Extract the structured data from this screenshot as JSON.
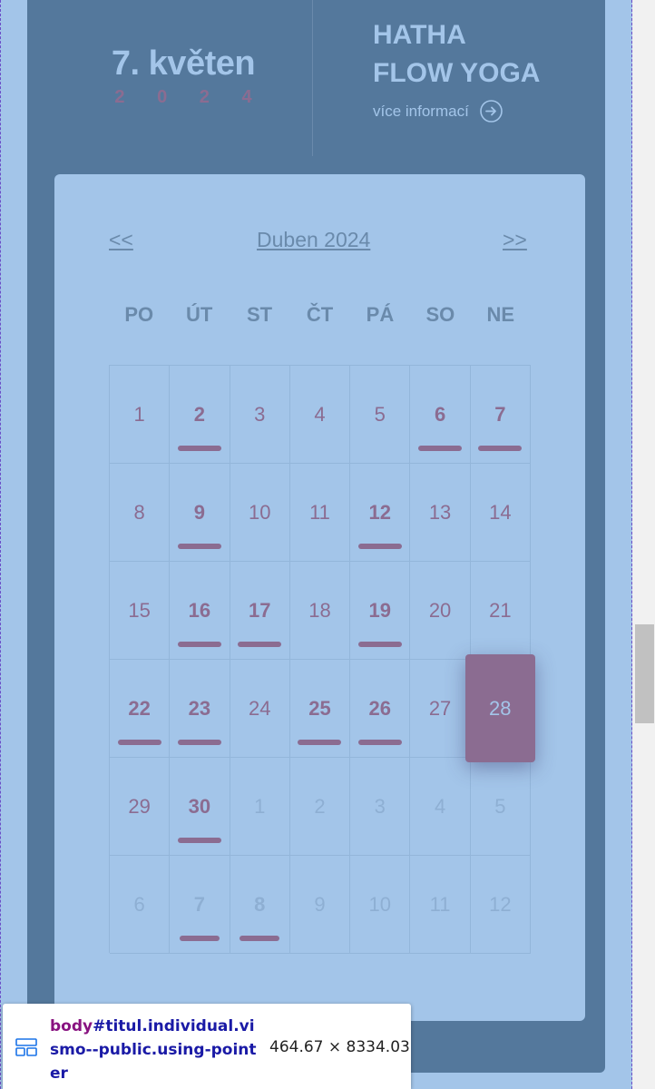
{
  "event": {
    "day_month": "7. květen",
    "year": "2 0 2 4",
    "title_line1": "HATHA",
    "title_line2": "FLOW YOGA",
    "more_label": "více informací"
  },
  "calendar": {
    "prev_label": "<<",
    "next_label": ">>",
    "month_label": "Duben 2024",
    "weekdays": [
      "PO",
      "ÚT",
      "ST",
      "ČT",
      "PÁ",
      "SO",
      "NE"
    ],
    "days": [
      {
        "label": "1",
        "event": false,
        "outside": false
      },
      {
        "label": "2",
        "event": true,
        "outside": false
      },
      {
        "label": "3",
        "event": false,
        "outside": false
      },
      {
        "label": "4",
        "event": false,
        "outside": false
      },
      {
        "label": "5",
        "event": false,
        "outside": false
      },
      {
        "label": "6",
        "event": true,
        "outside": false
      },
      {
        "label": "7",
        "event": true,
        "outside": false
      },
      {
        "label": "8",
        "event": false,
        "outside": false
      },
      {
        "label": "9",
        "event": true,
        "outside": false
      },
      {
        "label": "10",
        "event": false,
        "outside": false
      },
      {
        "label": "11",
        "event": false,
        "outside": false
      },
      {
        "label": "12",
        "event": true,
        "outside": false
      },
      {
        "label": "13",
        "event": false,
        "outside": false
      },
      {
        "label": "14",
        "event": false,
        "outside": false
      },
      {
        "label": "15",
        "event": false,
        "outside": false
      },
      {
        "label": "16",
        "event": true,
        "outside": false
      },
      {
        "label": "17",
        "event": true,
        "outside": false
      },
      {
        "label": "18",
        "event": false,
        "outside": false
      },
      {
        "label": "19",
        "event": true,
        "outside": false
      },
      {
        "label": "20",
        "event": false,
        "outside": false
      },
      {
        "label": "21",
        "event": false,
        "outside": false
      },
      {
        "label": "22",
        "event": true,
        "outside": false
      },
      {
        "label": "23",
        "event": true,
        "outside": false
      },
      {
        "label": "24",
        "event": false,
        "outside": false
      },
      {
        "label": "25",
        "event": true,
        "outside": false
      },
      {
        "label": "26",
        "event": true,
        "outside": false
      },
      {
        "label": "27",
        "event": false,
        "outside": false
      },
      {
        "label": "28",
        "event": false,
        "outside": false,
        "today": true
      },
      {
        "label": "29",
        "event": false,
        "outside": false
      },
      {
        "label": "30",
        "event": true,
        "outside": false
      },
      {
        "label": "1",
        "event": false,
        "outside": true
      },
      {
        "label": "2",
        "event": false,
        "outside": true
      },
      {
        "label": "3",
        "event": false,
        "outside": true
      },
      {
        "label": "4",
        "event": false,
        "outside": true
      },
      {
        "label": "5",
        "event": false,
        "outside": true
      },
      {
        "label": "6",
        "event": false,
        "outside": true
      },
      {
        "label": "7",
        "event": true,
        "outside": true
      },
      {
        "label": "8",
        "event": true,
        "outside": true
      },
      {
        "label": "9",
        "event": false,
        "outside": true
      },
      {
        "label": "10",
        "event": false,
        "outside": true
      },
      {
        "label": "11",
        "event": false,
        "outside": true
      },
      {
        "label": "12",
        "event": false,
        "outside": true
      }
    ]
  },
  "inspector": {
    "tag": "body",
    "selector_rest": "#titul.individual.vismo--public.using-pointer",
    "dimensions": "464.67 × 8334.03"
  },
  "colors": {
    "page_bg": "#a3c5e9",
    "card_bg": "#54789c",
    "accent": "#8b6c91",
    "muted": "#6a8aab"
  },
  "icons": {
    "more_link": "circle-arrow-right-icon",
    "inspector": "layout-grid-icon"
  }
}
